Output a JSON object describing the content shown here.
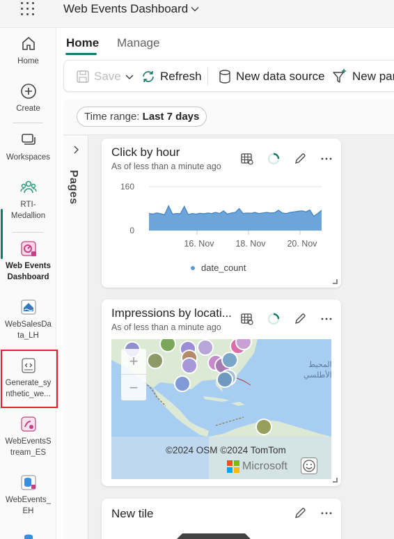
{
  "app": {
    "title": "Web Events Dashboard"
  },
  "rail": {
    "items": [
      {
        "label": "Home",
        "icon": "home-icon"
      },
      {
        "label": "Create",
        "icon": "create-icon"
      },
      {
        "label": "Workspaces",
        "icon": "workspaces-icon"
      },
      {
        "label": "RTI-\nMedallion",
        "icon": "workspace-people-icon"
      },
      {
        "label": "Web Events\nDashboard",
        "icon": "dashboard-icon"
      },
      {
        "label": "WebSalesDa\ntа_LH",
        "icon": "lakehouse-icon"
      },
      {
        "label": "Generate_sy\nnthetic_we...",
        "icon": "notebook-icon"
      },
      {
        "label": "WebEventsS\ntream_ES",
        "icon": "eventstream-icon"
      },
      {
        "label": "WebEvents_\nEH",
        "icon": "eventhouse-icon"
      }
    ]
  },
  "tabs": {
    "home": "Home",
    "manage": "Manage"
  },
  "toolbar": {
    "save": "Save",
    "refresh": "Refresh",
    "new_data_source": "New data source",
    "new_parameter": "New par"
  },
  "time_range": {
    "label": "Time range:",
    "value": "Last 7 days"
  },
  "pages": {
    "label": "Pages"
  },
  "tiles": {
    "click_by_hour": {
      "title": "Click by hour",
      "subtitle": "As of less than a minute ago",
      "legend": "date_count"
    },
    "impressions": {
      "title": "Impressions by locati...",
      "subtitle": "As of less than a minute ago",
      "attribution": "©2024 OSM  ©2024 TomTom",
      "brand": "Microsoft",
      "map_text_1": "المحيط",
      "map_text_2": "الأطلسي",
      "zoom_in": "+",
      "zoom_out": "−"
    },
    "new_tile": {
      "title": "New tile"
    }
  },
  "chart_data": {
    "type": "area",
    "x_ticks": [
      "16. Nov",
      "18. Nov",
      "20. Nov"
    ],
    "y_ticks": [
      "160",
      "0"
    ],
    "ylim": [
      0,
      160
    ],
    "series": [
      {
        "name": "date_count",
        "color": "#5b9bd5",
        "values": [
          62,
          60,
          64,
          61,
          58,
          90,
          60,
          62,
          61,
          88,
          58,
          62,
          60,
          63,
          61,
          64,
          62,
          66,
          62,
          72,
          60,
          64,
          66,
          80,
          62,
          64,
          63,
          66,
          62,
          64,
          66,
          64,
          65,
          74,
          64,
          62,
          66,
          68,
          70,
          72,
          68,
          75,
          52,
          62,
          74
        ]
      }
    ]
  }
}
